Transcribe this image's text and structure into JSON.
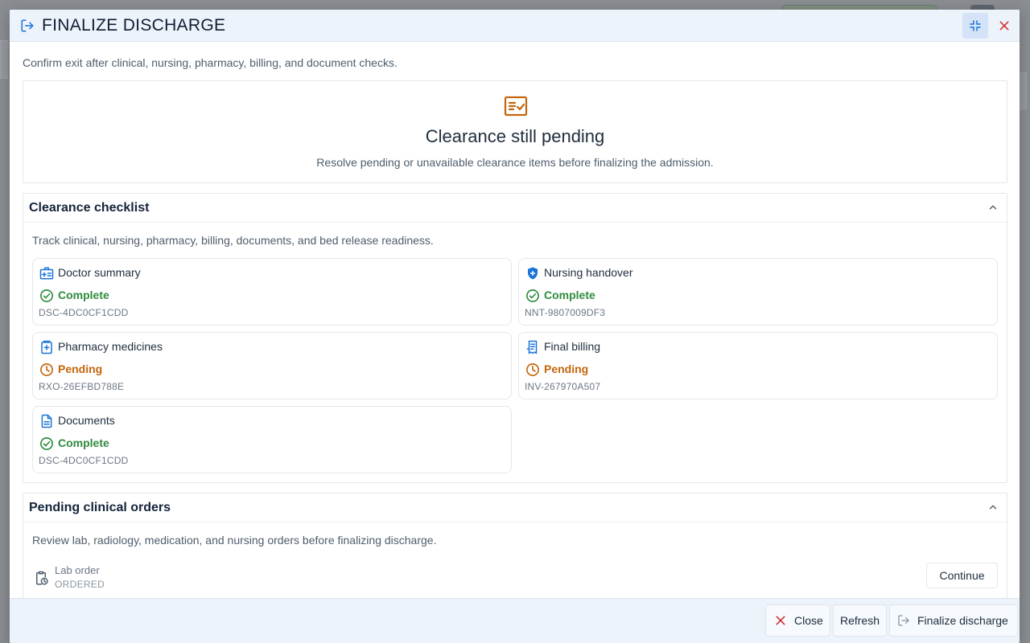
{
  "dialog": {
    "title": "FINALIZE DISCHARGE",
    "subtitle": "Confirm exit after clinical, nursing, pharmacy, billing, and document checks."
  },
  "status": {
    "title": "Clearance still pending",
    "text": "Resolve pending or unavailable clearance items before finalizing the admission.",
    "accent_color": "#c4660b"
  },
  "checklist": {
    "title": "Clearance checklist",
    "description": "Track clinical, nursing, pharmacy, billing, documents, and bed release readiness.",
    "items": [
      {
        "label": "Doctor summary",
        "status": "Complete",
        "ref": "DSC-4DC0CF1CDD",
        "icon": "medical-id-icon"
      },
      {
        "label": "Nursing handover",
        "status": "Complete",
        "ref": "NNT-9807009DF3",
        "icon": "shield-plus-icon"
      },
      {
        "label": "Pharmacy medicines",
        "status": "Pending",
        "ref": "RXO-26EFBD788E",
        "icon": "medicine-box-icon"
      },
      {
        "label": "Final billing",
        "status": "Pending",
        "ref": "INV-267970A507",
        "icon": "receipt-icon"
      },
      {
        "label": "Documents",
        "status": "Complete",
        "ref": "DSC-4DC0CF1CDD",
        "icon": "document-icon"
      }
    ]
  },
  "orders": {
    "title": "Pending clinical orders",
    "description": "Review lab, radiology, medication, and nursing orders before finalizing discharge.",
    "items": [
      {
        "label": "Lab order",
        "state": "ORDERED",
        "action": "Continue"
      }
    ]
  },
  "footer": {
    "close_label": "Close",
    "refresh_label": "Refresh",
    "finalize_label": "Finalize discharge"
  },
  "colors": {
    "primary": "#1a73d9",
    "complete": "#2e8b3e",
    "pending": "#c4660b",
    "danger": "#d32f2f"
  }
}
